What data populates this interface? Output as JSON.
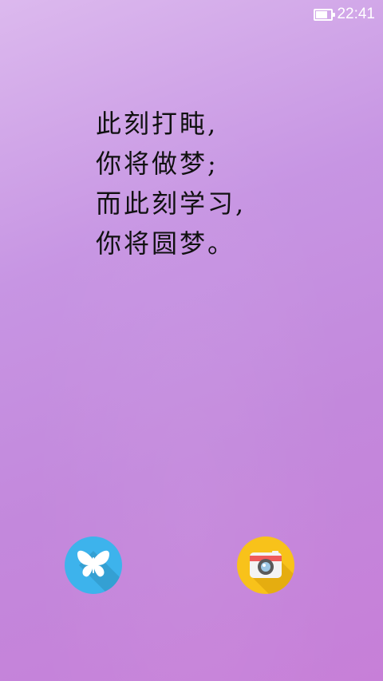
{
  "status_bar": {
    "time": "22:41",
    "battery_level": 0.85,
    "icons": [
      "battery-icon"
    ]
  },
  "poem": {
    "lines": [
      "此刻打盹,",
      "你将做梦;",
      "而此刻学习,",
      "你将圆梦。"
    ]
  },
  "shortcuts": {
    "left": {
      "icon": "butterfly-icon",
      "color": "#3db3ec"
    },
    "right": {
      "icon": "camera-icon",
      "color": "#f8c21a"
    }
  }
}
